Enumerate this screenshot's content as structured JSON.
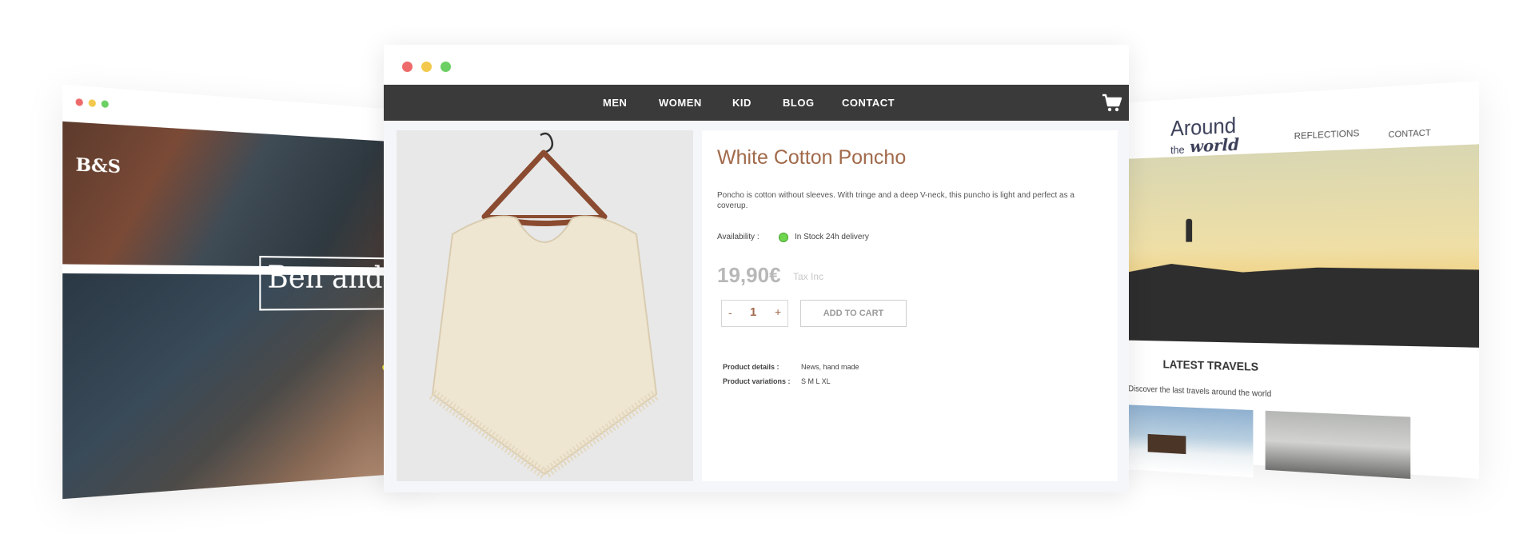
{
  "left_site": {
    "logo": "B&S",
    "hero_text": "Ben and So"
  },
  "right_site": {
    "logo_line1": "Around",
    "logo_line2a": "the",
    "logo_line2b": "world",
    "nav": [
      "REFLECTIONS",
      "CONTACT"
    ],
    "section_title": "LATEST TRAVELS",
    "section_subtitle": "Discover the last travels around the world"
  },
  "main": {
    "nav": [
      "MEN",
      "WOMEN",
      "KID",
      "BLOG",
      "CONTACT"
    ],
    "cart_icon": "cart-icon",
    "product": {
      "title": "White Cotton Poncho",
      "description": "Poncho is cotton without sleeves. With tringe and a deep V-neck, this puncho is light and perfect as a coverup.",
      "availability_label": "Availability :",
      "availability_text": "In Stock 24h delivery",
      "price": "19,90€",
      "tax_label": "Tax Inc",
      "quantity_minus": "-",
      "quantity": "1",
      "quantity_plus": "+",
      "add_to_cart": "ADD TO CART",
      "details": [
        {
          "label": "Product details :",
          "value": "News, hand made"
        },
        {
          "label": "Product variations :",
          "value": "S M L XL"
        }
      ]
    }
  },
  "colors": {
    "accent": "#a16a4b",
    "nav_bg": "#3a3a3a",
    "in_stock": "#6fd650",
    "price": "#b8b8b8"
  }
}
